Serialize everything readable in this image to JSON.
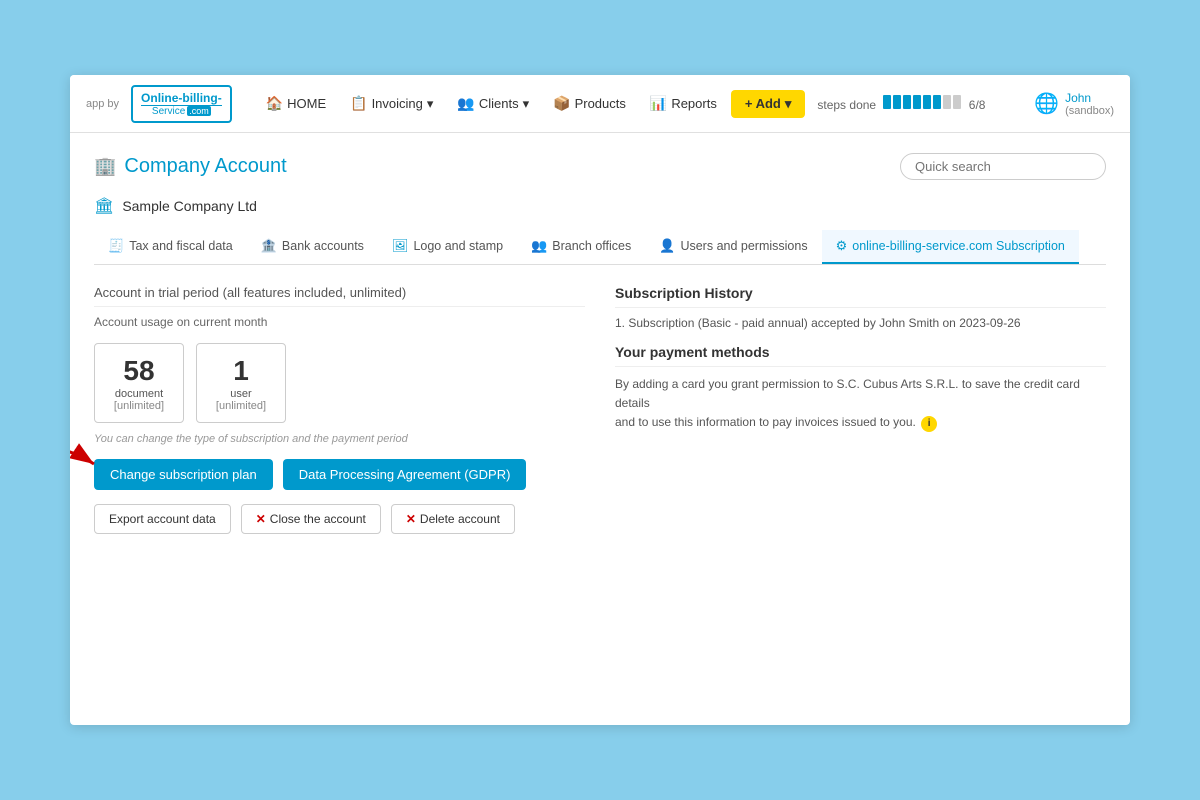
{
  "app": {
    "app_by_label": "app by",
    "logo_line1": "Online-billing-",
    "logo_line2": "Service",
    "logo_com": ".com"
  },
  "nav": {
    "home_label": "HOME",
    "invoicing_label": "Invoicing",
    "clients_label": "Clients",
    "products_label": "Products",
    "reports_label": "Reports",
    "add_label": "+ Add",
    "steps_label": "steps done",
    "steps_count": "6/8"
  },
  "user": {
    "name": "John",
    "sandbox": "(sandbox)"
  },
  "page": {
    "title": "Company Account",
    "quick_search_placeholder": "Quick search"
  },
  "company": {
    "name": "Sample Company Ltd"
  },
  "tabs": [
    {
      "id": "tax",
      "label": "Tax and fiscal data",
      "icon": "🧾"
    },
    {
      "id": "bank",
      "label": "Bank accounts",
      "icon": "🏦"
    },
    {
      "id": "logo",
      "label": "Logo and stamp",
      "icon": "🖼"
    },
    {
      "id": "branch",
      "label": "Branch offices",
      "icon": "👥"
    },
    {
      "id": "users",
      "label": "Users and permissions",
      "icon": "👤"
    },
    {
      "id": "subscription",
      "label": "online-billing-service.com Subscription",
      "icon": "⚙",
      "active": true
    }
  ],
  "left": {
    "section_title": "Account in trial period (all features included, unlimited)",
    "usage_label": "Account usage on current month",
    "stats": [
      {
        "number": "58",
        "label": "document",
        "sublabel": "[unlimited]"
      },
      {
        "number": "1",
        "label": "user",
        "sublabel": "[unlimited]"
      }
    ],
    "hint": "You can change the type of subscription and the payment period",
    "btn_change_plan": "Change subscription plan",
    "btn_gdpr": "Data Processing Agreement (GDPR)",
    "btn_export": "Export account data",
    "btn_close": "Close the account",
    "btn_delete": "Delete account"
  },
  "right": {
    "subscription_title": "Subscription History",
    "history_item": "1. Subscription (Basic - paid annual) accepted by John Smith on 2023-09-26",
    "payment_title": "Your payment methods",
    "payment_text_1": "By adding a card you grant permission to S.C. Cubus Arts S.R.L. to save the credit card details",
    "payment_text_2": "and to use this information to pay invoices issued to you."
  }
}
